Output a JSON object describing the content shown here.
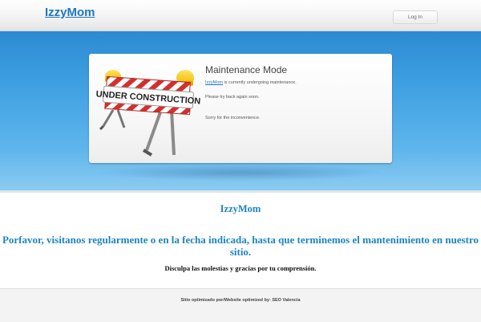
{
  "header": {
    "logo_text": "IzzyMom",
    "login_label": "Log In"
  },
  "card": {
    "title": "Maintenance Mode",
    "site_link": "IzzyMom",
    "line1_rest": " is currently undergoing maintenance.",
    "line2": "Please try back again soon.",
    "line3": "Sorry for the inconvenience.",
    "sign_text": "UNDER CONSTRUCTION"
  },
  "main": {
    "site_name": "IzzyMom",
    "message": "Porfavor, visitanos regularmente o en la fecha indicada, hasta que terminemos el mantenimiento en nuestro sitio.",
    "sub_message": "Disculpa las molestias y gracias por tu comprensión."
  },
  "footer": {
    "credit": "Sitio optimizado por/Website optimized by: SEO Valencia"
  },
  "colors": {
    "brand_blue": "#1f78c1",
    "hero_blue": "#3c9ee0"
  }
}
